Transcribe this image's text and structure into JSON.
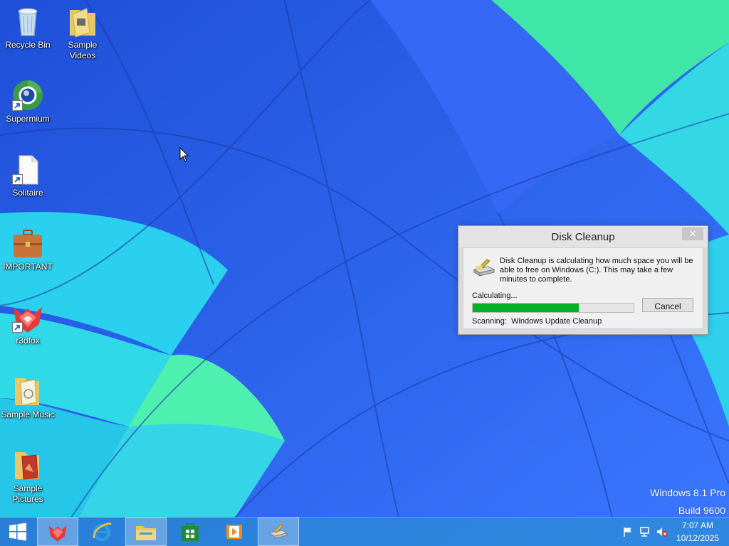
{
  "desktop": {
    "icons": [
      {
        "label": "Recycle Bin",
        "icon": "recycle-bin-icon"
      },
      {
        "label": "Sample Videos",
        "icon": "folder-videos-icon"
      },
      {
        "label": "Supermium",
        "icon": "supermium-browser-icon"
      },
      {
        "label": "Solitaire",
        "icon": "document-icon"
      },
      {
        "label": "IMPORTANT",
        "icon": "briefcase-icon"
      },
      {
        "label": "r3dfox",
        "icon": "r3dfox-icon"
      },
      {
        "label": "Sample Music",
        "icon": "folder-music-icon"
      },
      {
        "label": "Sample Pictures",
        "icon": "folder-pictures-icon"
      }
    ]
  },
  "dialog": {
    "title": "Disk Cleanup",
    "close_label": "✕",
    "message": "Disk Cleanup is calculating how much space you will be able to free on Windows (C:). This may take a few minutes to complete.",
    "status": "Calculating...",
    "progress": 0.66,
    "cancel_label": "Cancel",
    "scanning_label": "Scanning:",
    "scanning_item": "Windows Update Cleanup"
  },
  "watermark": {
    "edition": "Windows 8.1 Pro",
    "build": "Build 9600"
  },
  "taskbar": {
    "buttons": [
      {
        "name": "start-button",
        "icon": "windows-logo-icon"
      },
      {
        "name": "r3dfox",
        "icon": "r3dfox-icon"
      },
      {
        "name": "internet-explorer",
        "icon": "internet-explorer-icon"
      },
      {
        "name": "file-explorer",
        "icon": "file-explorer-icon"
      },
      {
        "name": "store",
        "icon": "store-icon"
      },
      {
        "name": "media-player",
        "icon": "media-player-icon"
      },
      {
        "name": "disk-cleanup",
        "icon": "disk-cleanup-icon"
      }
    ],
    "tray": {
      "time": "7:07 AM",
      "date": "10/12/2025"
    }
  },
  "colors": {
    "progress_fill": "#06b025",
    "taskbar": "#3a9fcf"
  }
}
